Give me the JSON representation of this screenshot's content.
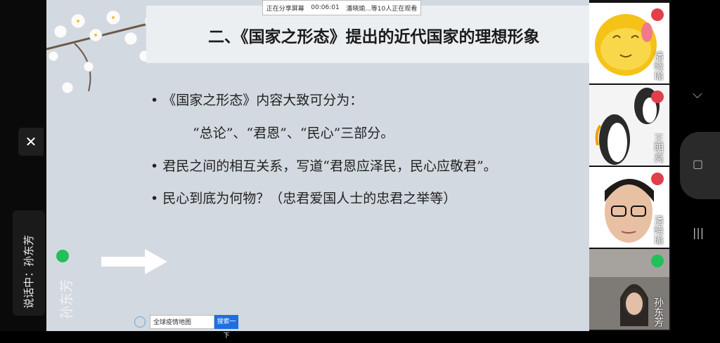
{
  "meeting": {
    "share_status": "正在分享屏幕",
    "elapsed": "00:06:01",
    "viewers": "潘晓瑜...等10人正在观看",
    "speaking_label": "说话中：孙东芳",
    "presenter_name": "孙东芳"
  },
  "slide": {
    "title": "二、《国家之形态》提出的近代国家的理想形象",
    "bullets": [
      "• 《国家之形态》内容大致可分为：",
      "“总论”、“君恩”、“民心”三部分。",
      "• 君民之间的相互关系，写道“君恩应泽民，民心应敬君”。",
      "• 民心到底为何物？（忠君爱国人士的忠君之举等）"
    ]
  },
  "taskbar": {
    "search_text": "全球疫情地图",
    "search_button": "搜索一下"
  },
  "participants": [
    {
      "name": "潘晓瑜",
      "status": "muted",
      "kind": "emoji"
    },
    {
      "name": "王明亮",
      "status": "muted",
      "kind": "penguin"
    },
    {
      "name": "潘晓瑜",
      "status": "muted",
      "kind": "face"
    },
    {
      "name": "孙东芳",
      "status": "live",
      "kind": "camera"
    }
  ],
  "nav": {
    "collapse_icon": "chevron-down-icon",
    "window_icon": "square-icon",
    "menu_icon": "menu-lines-icon"
  },
  "colors": {
    "mic_live": "#20c05a",
    "mic_muted": "#e0404a",
    "accent_orange": "#e88a2a"
  }
}
